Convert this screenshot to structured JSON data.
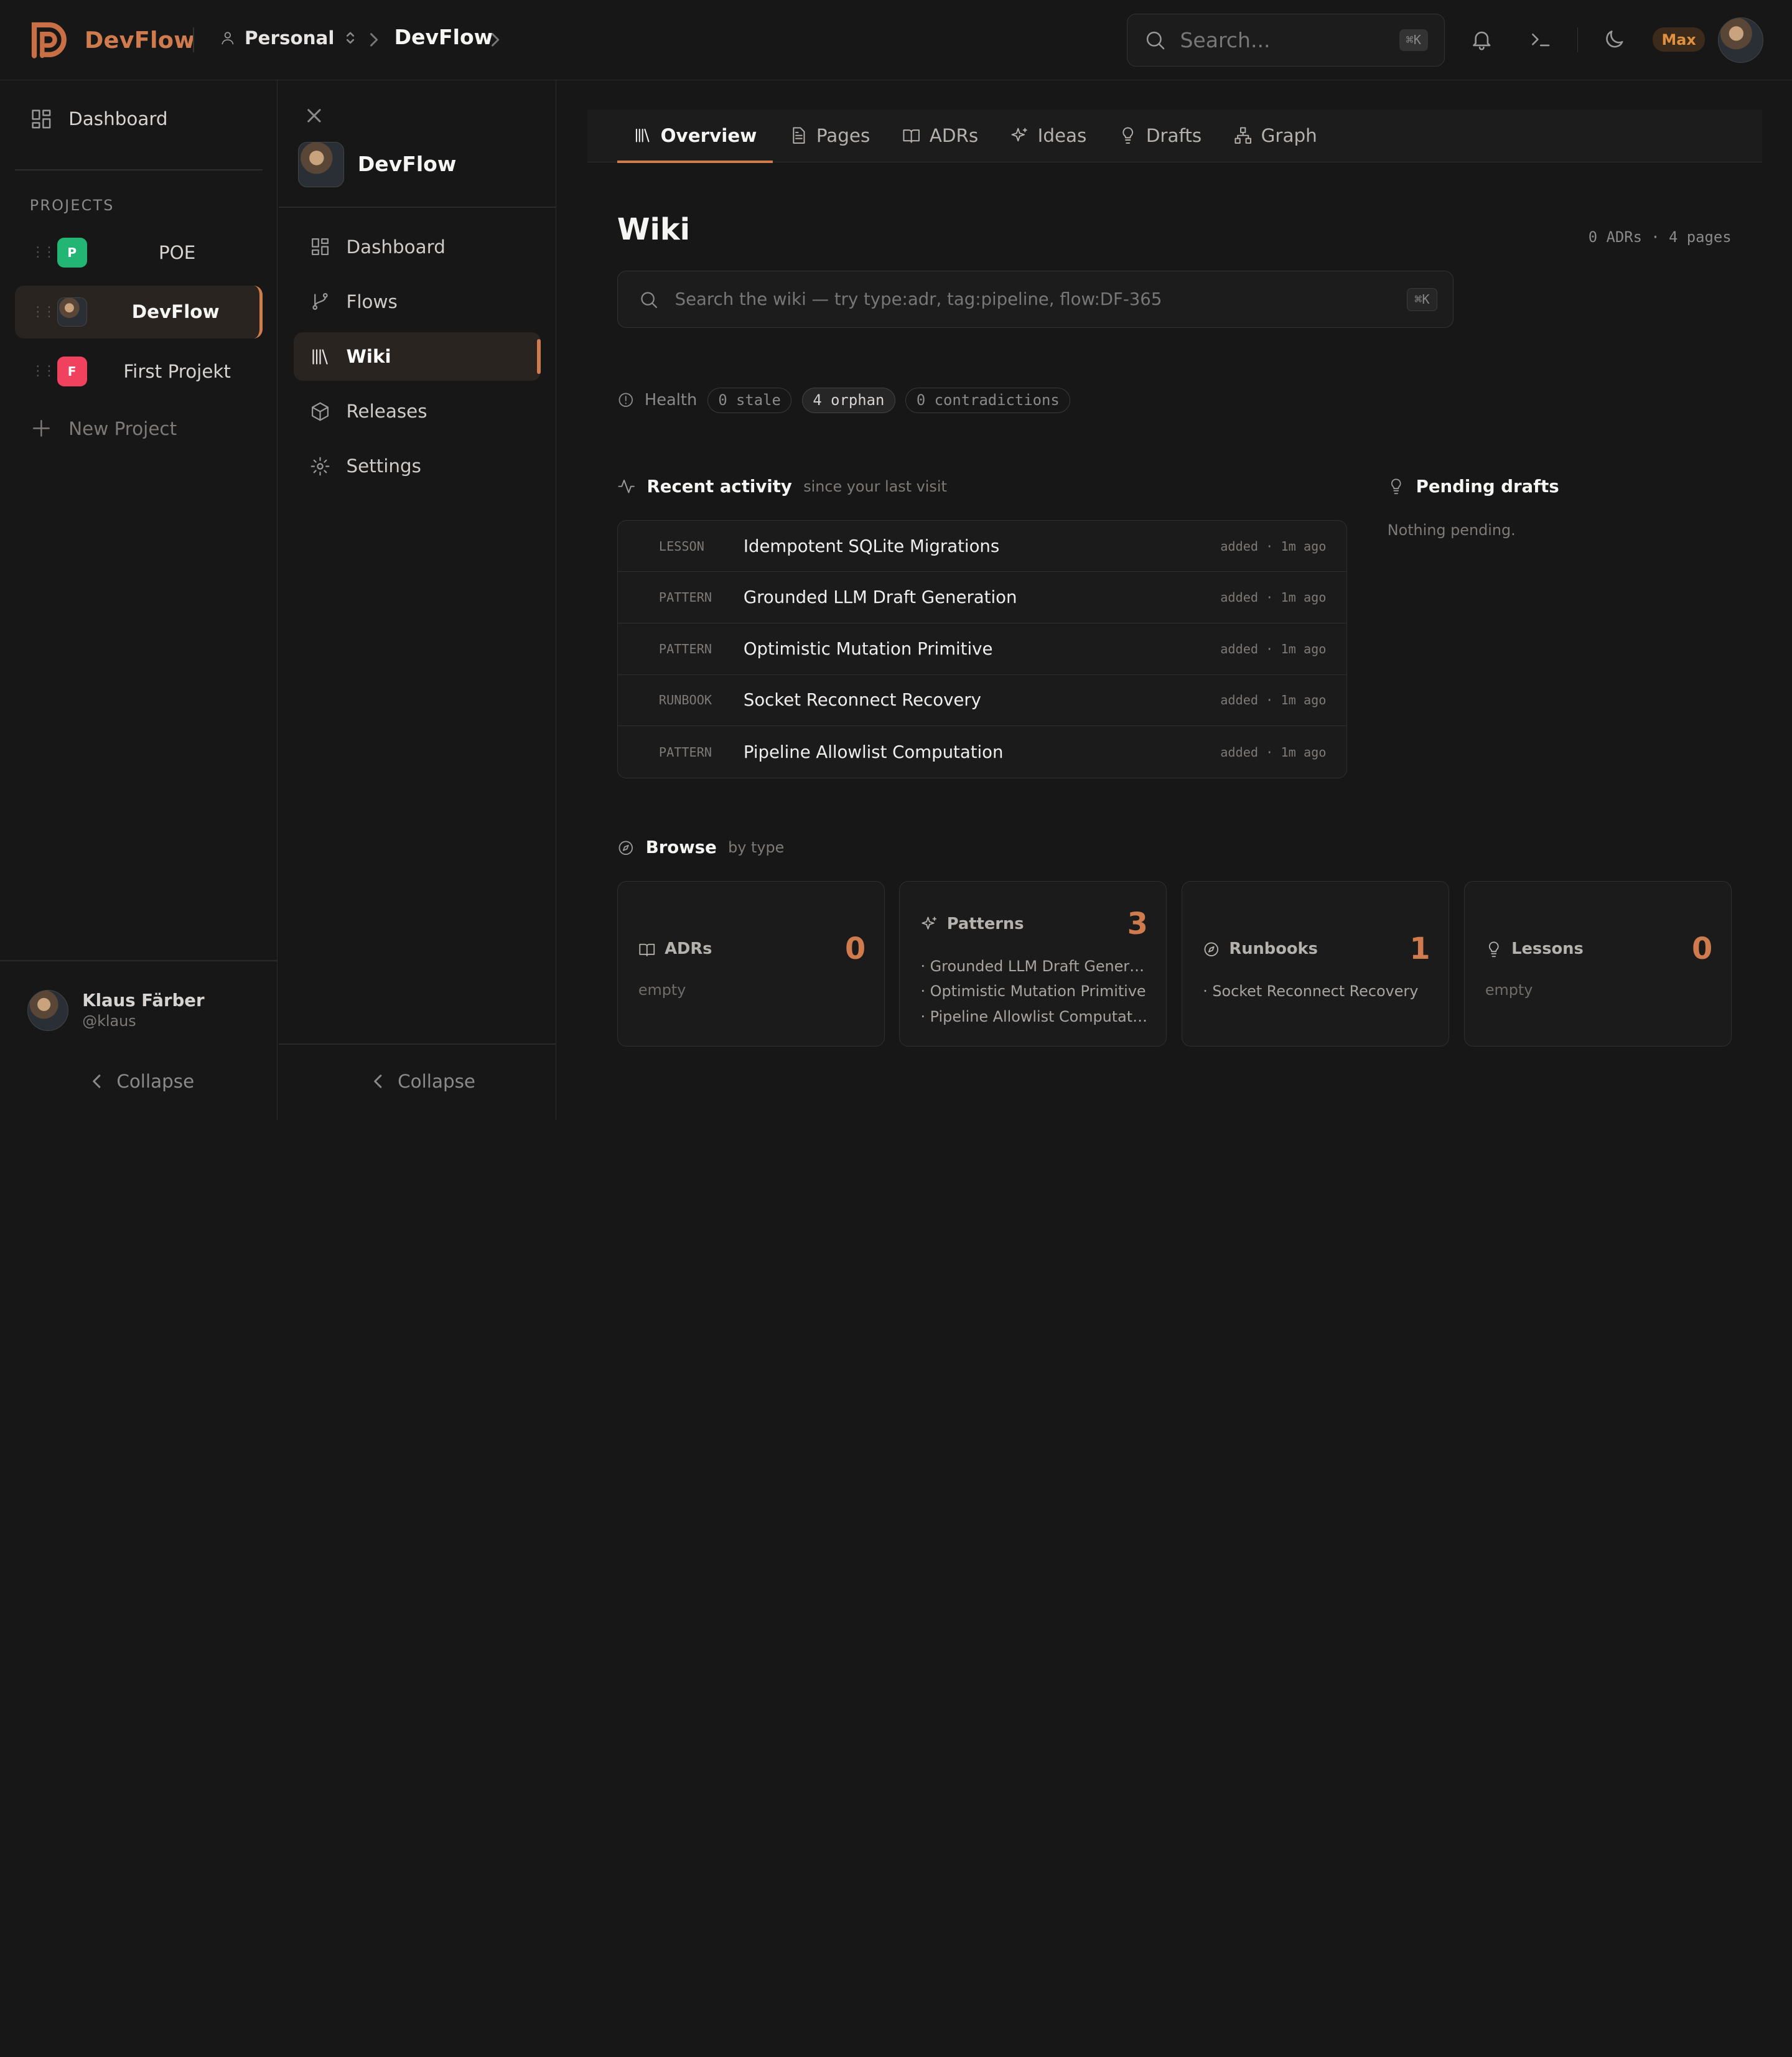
{
  "header": {
    "brand": "DevFlow",
    "workspace": "Personal",
    "project": "DevFlow",
    "search_placeholder": "Search...",
    "search_shortcut": "⌘K",
    "user_badge": "Max"
  },
  "sidebar": {
    "dashboard": "Dashboard",
    "projects_label": "PROJECTS",
    "projects": [
      {
        "initial": "P",
        "name": "POE",
        "color": "#22b573"
      },
      {
        "initial": "",
        "name": "DevFlow",
        "color": ""
      },
      {
        "initial": "F",
        "name": "First Projekt",
        "color": "#f0425e"
      }
    ],
    "new_project": "New Project",
    "user": {
      "name": "Klaus Färber",
      "handle": "@klaus"
    },
    "collapse": "Collapse"
  },
  "project_nav": {
    "title": "DevFlow",
    "items": [
      "Dashboard",
      "Flows",
      "Wiki",
      "Releases",
      "Settings"
    ],
    "collapse": "Collapse"
  },
  "tabs": [
    "Overview",
    "Pages",
    "ADRs",
    "Ideas",
    "Drafts",
    "Graph"
  ],
  "wiki": {
    "title": "Wiki",
    "meta": "0 ADRs · 4 pages",
    "search_placeholder": "Search the wiki — try type:adr, tag:pipeline, flow:DF-365",
    "search_shortcut": "⌘K",
    "health_label": "Health",
    "health": [
      "0 stale",
      "4 orphan",
      "0 contradictions"
    ]
  },
  "recent": {
    "title": "Recent activity",
    "subtitle": "since your last visit",
    "items": [
      {
        "type": "LESSON",
        "title": "Idempotent SQLite Migrations",
        "meta": "added · 1m ago"
      },
      {
        "type": "PATTERN",
        "title": "Grounded LLM Draft Generation",
        "meta": "added · 1m ago"
      },
      {
        "type": "PATTERN",
        "title": "Optimistic Mutation Primitive",
        "meta": "added · 1m ago"
      },
      {
        "type": "RUNBOOK",
        "title": "Socket Reconnect Recovery",
        "meta": "added · 1m ago"
      },
      {
        "type": "PATTERN",
        "title": "Pipeline Allowlist Computation",
        "meta": "added · 1m ago"
      }
    ]
  },
  "pending": {
    "title": "Pending drafts",
    "empty": "Nothing pending."
  },
  "browse": {
    "title": "Browse",
    "subtitle": "by type",
    "cards": [
      {
        "label": "ADRs",
        "count": "0",
        "items": [],
        "empty": "empty"
      },
      {
        "label": "Patterns",
        "count": "3",
        "items": [
          "· Grounded LLM Draft Generat...",
          "· Optimistic Mutation Primitive",
          "· Pipeline Allowlist Computation"
        ],
        "empty": ""
      },
      {
        "label": "Runbooks",
        "count": "1",
        "items": [
          "· Socket Reconnect Recovery"
        ],
        "empty": ""
      },
      {
        "label": "Lessons",
        "count": "0",
        "items": [],
        "empty": "empty"
      }
    ]
  },
  "colors": {
    "accent": "#d07b4d",
    "background": "#171717"
  }
}
